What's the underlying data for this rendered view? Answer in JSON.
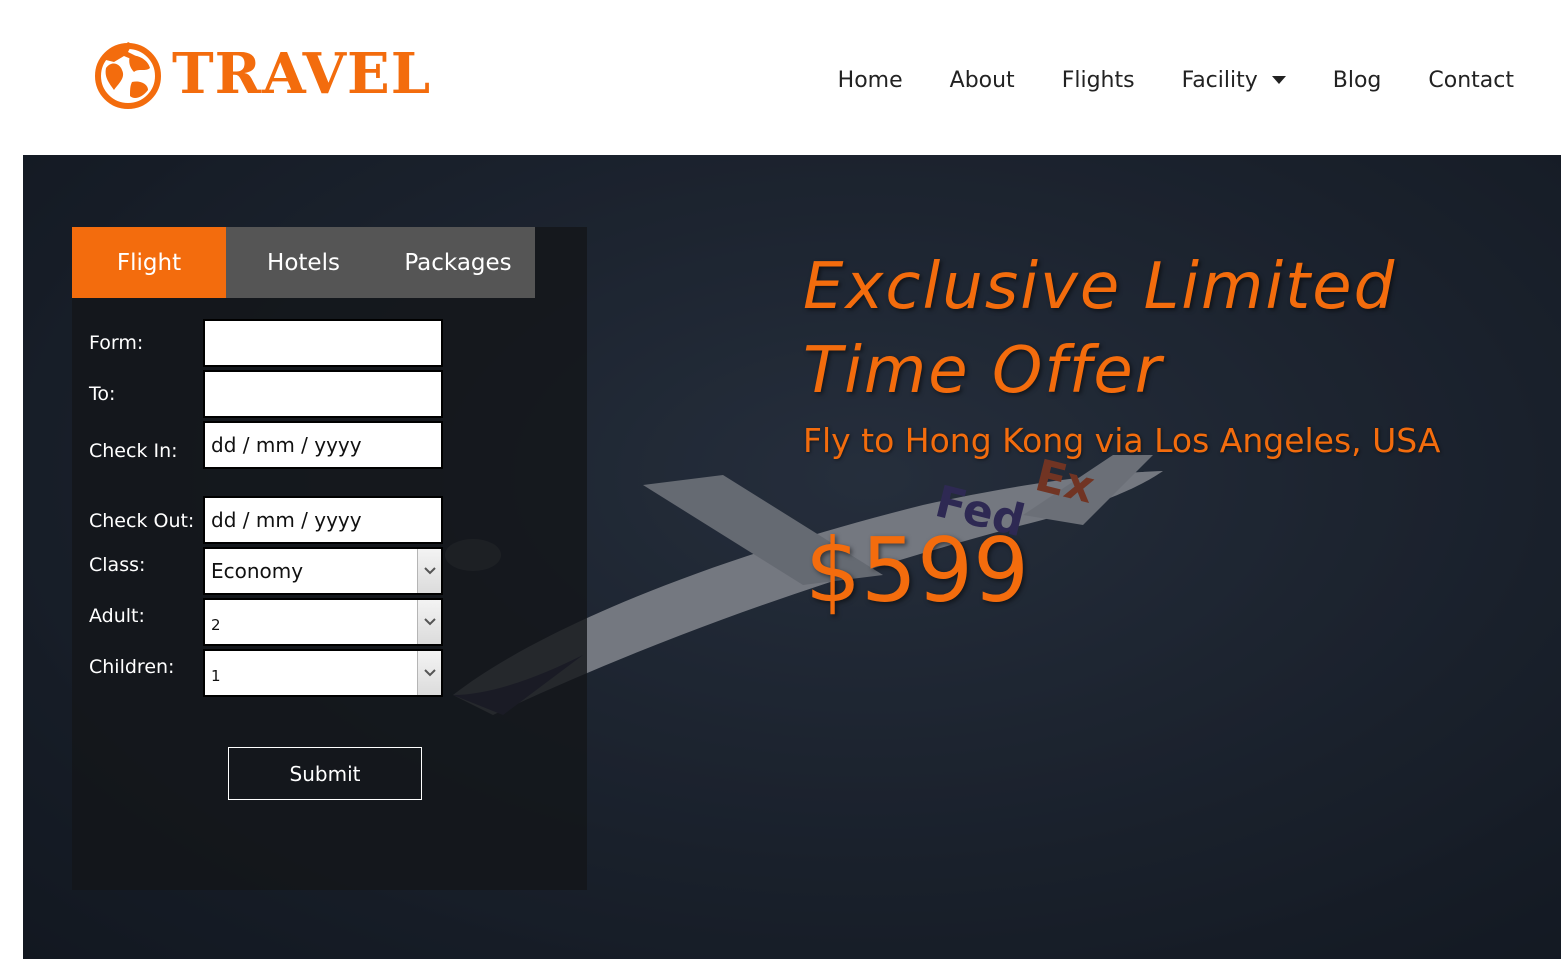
{
  "brand": {
    "name": "TRAVEL",
    "logo_icon": "globe-plane-icon",
    "color": "#f36c0d"
  },
  "nav": {
    "items": [
      {
        "label": "Home"
      },
      {
        "label": "About"
      },
      {
        "label": "Flights"
      },
      {
        "label": "Facility",
        "dropdown": true
      },
      {
        "label": "Blog"
      },
      {
        "label": "Contact"
      }
    ]
  },
  "booking": {
    "tabs": [
      {
        "label": "Flight",
        "active": true
      },
      {
        "label": "Hotels",
        "active": false
      },
      {
        "label": "Packages",
        "active": false
      }
    ],
    "fields": {
      "from": {
        "label": "Form:",
        "value": ""
      },
      "to": {
        "label": "To:",
        "value": ""
      },
      "check_in": {
        "label": "Check In:",
        "placeholder": "dd / mm / yyyy"
      },
      "check_out": {
        "label": "Check Out:",
        "placeholder": "dd / mm / yyyy"
      },
      "class": {
        "label": "Class:",
        "value": "Economy"
      },
      "adult": {
        "label": "Adult:",
        "value": "2"
      },
      "children": {
        "label": "Children:",
        "value": "1"
      }
    },
    "submit_label": "Submit"
  },
  "offer": {
    "title_line1": "Exclusive Limited",
    "title_line2": "Time Offer",
    "subtitle": "Fly to Hong Kong via Los Angeles, USA",
    "price": "$599"
  },
  "colors": {
    "accent": "#f36c0d",
    "tab_inactive": "#555555",
    "nav_text": "#222222"
  }
}
